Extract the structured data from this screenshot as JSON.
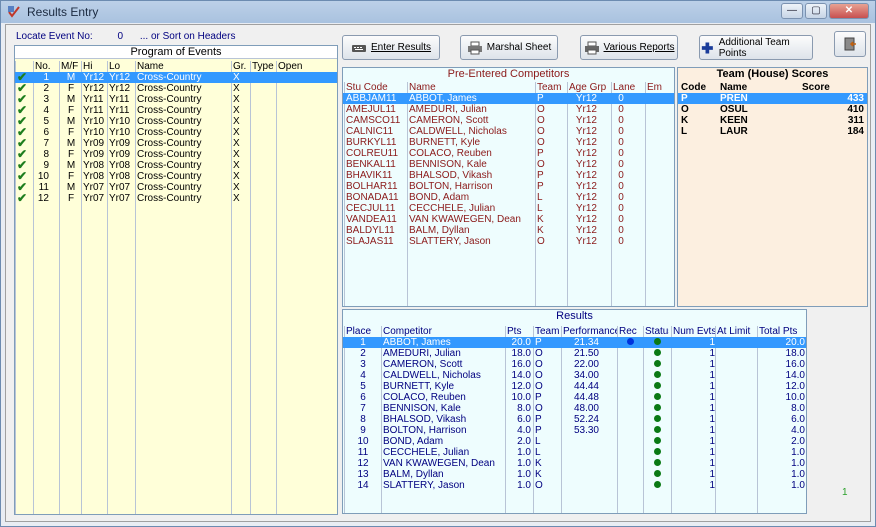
{
  "window": {
    "title": "Results Entry",
    "min_glyph": "—",
    "max_glyph": "▢",
    "close_glyph": "✕"
  },
  "locate": {
    "label": "Locate Event No:",
    "value": "0",
    "hint": "... or Sort on Headers"
  },
  "program": {
    "title": "Program of Events",
    "headers": [
      "No.",
      "M/F",
      "Hi",
      "Lo",
      "Name",
      "Gr.",
      "Type",
      "Open"
    ],
    "check_glyph": "✔",
    "rows": [
      [
        "1",
        "M",
        "Yr12",
        "Yr12",
        "Cross-Country",
        "X",
        "",
        ""
      ],
      [
        "2",
        "F",
        "Yr12",
        "Yr12",
        "Cross-Country",
        "X",
        "",
        ""
      ],
      [
        "3",
        "M",
        "Yr11",
        "Yr11",
        "Cross-Country",
        "X",
        "",
        ""
      ],
      [
        "4",
        "F",
        "Yr11",
        "Yr11",
        "Cross-Country",
        "X",
        "",
        ""
      ],
      [
        "5",
        "M",
        "Yr10",
        "Yr10",
        "Cross-Country",
        "X",
        "",
        ""
      ],
      [
        "6",
        "F",
        "Yr10",
        "Yr10",
        "Cross-Country",
        "X",
        "",
        ""
      ],
      [
        "7",
        "M",
        "Yr09",
        "Yr09",
        "Cross-Country",
        "X",
        "",
        ""
      ],
      [
        "8",
        "F",
        "Yr09",
        "Yr09",
        "Cross-Country",
        "X",
        "",
        ""
      ],
      [
        "9",
        "M",
        "Yr08",
        "Yr08",
        "Cross-Country",
        "X",
        "",
        ""
      ],
      [
        "10",
        "F",
        "Yr08",
        "Yr08",
        "Cross-Country",
        "X",
        "",
        ""
      ],
      [
        "11",
        "M",
        "Yr07",
        "Yr07",
        "Cross-Country",
        "X",
        "",
        ""
      ],
      [
        "12",
        "F",
        "Yr07",
        "Yr07",
        "Cross-Country",
        "X",
        "",
        ""
      ]
    ]
  },
  "toolbar": {
    "enter_results": "Enter Results",
    "marshal_sheet": "Marshal Sheet",
    "various_reports": "Various Reports",
    "additional_team_points": "Additional Team Points"
  },
  "competitors": {
    "title": "Pre-Entered Competitors",
    "headers": [
      "Stu Code",
      "Name",
      "Team",
      "Age Grp",
      "Lane",
      "Em"
    ],
    "rows": [
      [
        "ABBJAM11",
        "ABBOT, James",
        "P",
        "Yr12",
        "0",
        ""
      ],
      [
        "AMEJUL11",
        "AMEDURI, Julian",
        "O",
        "Yr12",
        "0",
        ""
      ],
      [
        "CAMSCO11",
        "CAMERON, Scott",
        "O",
        "Yr12",
        "0",
        ""
      ],
      [
        "CALNIC11",
        "CALDWELL, Nicholas",
        "O",
        "Yr12",
        "0",
        ""
      ],
      [
        "BURKYL11",
        "BURNETT, Kyle",
        "O",
        "Yr12",
        "0",
        ""
      ],
      [
        "COLREU11",
        "COLACO, Reuben",
        "P",
        "Yr12",
        "0",
        ""
      ],
      [
        "BENKAL11",
        "BENNISON, Kale",
        "O",
        "Yr12",
        "0",
        ""
      ],
      [
        "BHAVIK11",
        "BHALSOD, Vikash",
        "P",
        "Yr12",
        "0",
        ""
      ],
      [
        "BOLHAR11",
        "BOLTON, Harrison",
        "P",
        "Yr12",
        "0",
        ""
      ],
      [
        "BONADA11",
        "BOND, Adam",
        "L",
        "Yr12",
        "0",
        ""
      ],
      [
        "CECJUL11",
        "CECCHELE, Julian",
        "L",
        "Yr12",
        "0",
        ""
      ],
      [
        "VANDEA11",
        "VAN KWAWEGEN, Dean",
        "K",
        "Yr12",
        "0",
        ""
      ],
      [
        "BALDYL11",
        "BALM, Dyllan",
        "K",
        "Yr12",
        "0",
        ""
      ],
      [
        "SLAJAS11",
        "SLATTERY, Jason",
        "O",
        "Yr12",
        "0",
        ""
      ]
    ]
  },
  "team_scores": {
    "title": "Team (House) Scores",
    "headers": [
      "Code",
      "Name",
      "Score"
    ],
    "rows": [
      [
        "P",
        "PREN",
        "433"
      ],
      [
        "O",
        "OSUL",
        "410"
      ],
      [
        "K",
        "KEEN",
        "311"
      ],
      [
        "L",
        "LAUR",
        "184"
      ]
    ]
  },
  "results": {
    "title": "Results",
    "headers": [
      "Place",
      "Competitor",
      "Pts",
      "Team",
      "Performance",
      "Rec",
      "Status",
      "Num Evts",
      "At Limit",
      "Total Pts"
    ],
    "rows": [
      [
        "1",
        "ABBOT, James",
        "20.0",
        "P",
        "21.34",
        "blue",
        "green",
        "1",
        "",
        "20.0"
      ],
      [
        "2",
        "AMEDURI, Julian",
        "18.0",
        "O",
        "21.50",
        "",
        "green",
        "1",
        "",
        "18.0"
      ],
      [
        "3",
        "CAMERON, Scott",
        "16.0",
        "O",
        "22.00",
        "",
        "green",
        "1",
        "",
        "16.0"
      ],
      [
        "4",
        "CALDWELL, Nicholas",
        "14.0",
        "O",
        "34.00",
        "",
        "green",
        "1",
        "",
        "14.0"
      ],
      [
        "5",
        "BURNETT, Kyle",
        "12.0",
        "O",
        "44.44",
        "",
        "green",
        "1",
        "",
        "12.0"
      ],
      [
        "6",
        "COLACO, Reuben",
        "10.0",
        "P",
        "44.48",
        "",
        "green",
        "1",
        "",
        "10.0"
      ],
      [
        "7",
        "BENNISON, Kale",
        "8.0",
        "O",
        "48.00",
        "",
        "green",
        "1",
        "",
        "8.0"
      ],
      [
        "8",
        "BHALSOD, Vikash",
        "6.0",
        "P",
        "52.24",
        "",
        "green",
        "1",
        "",
        "6.0"
      ],
      [
        "9",
        "BOLTON, Harrison",
        "4.0",
        "P",
        "53.30",
        "",
        "green",
        "1",
        "",
        "4.0"
      ],
      [
        "10",
        "BOND, Adam",
        "2.0",
        "L",
        "",
        "",
        "green",
        "1",
        "",
        "2.0"
      ],
      [
        "11",
        "CECCHELE, Julian",
        "1.0",
        "L",
        "",
        "",
        "green",
        "1",
        "",
        "1.0"
      ],
      [
        "12",
        "VAN KWAWEGEN, Dean",
        "1.0",
        "K",
        "",
        "",
        "green",
        "1",
        "",
        "1.0"
      ],
      [
        "13",
        "BALM, Dyllan",
        "1.0",
        "K",
        "",
        "",
        "green",
        "1",
        "",
        "1.0"
      ],
      [
        "14",
        "SLATTERY, Jason",
        "1.0",
        "O",
        "",
        "",
        "green",
        "1",
        "",
        "1.0"
      ]
    ]
  },
  "footer_indicator": "1",
  "colors": {
    "selection": "#3399ff",
    "yellow_panel": "#ffffd9",
    "cyan_panel": "#eefdfe",
    "peach_panel": "#fcefe0",
    "green_dot": "#0a7a14",
    "blue_dot": "#0033dd"
  }
}
